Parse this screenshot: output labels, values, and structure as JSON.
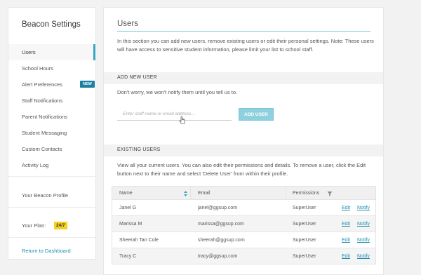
{
  "sidebar": {
    "title": "Beacon Settings",
    "items": [
      {
        "label": "Users"
      },
      {
        "label": "School Hours"
      },
      {
        "label": "Alert Preferences",
        "badge": "NEW"
      },
      {
        "label": "Staff Notifications"
      },
      {
        "label": "Parent Notifications"
      },
      {
        "label": "Student Messaging"
      },
      {
        "label": "Custom Contacts"
      },
      {
        "label": "Activity Log"
      }
    ],
    "profile_label": "Your Beacon Profile",
    "plan_label": "Your Plan:",
    "plan_badge": "24/7",
    "return_label": "Return to Dashboard",
    "accent_color": "#3aa3c2",
    "badge_new_color": "#1d7ea6",
    "badge_plan_color": "#f6d21e"
  },
  "main": {
    "title": "Users",
    "intro": "In this section you can add new users, remove existing users or edit their personal settings. Note: These users will have access to sensitive student information, please limit your list to school staff.",
    "add_section": {
      "heading": "ADD NEW USER",
      "note": "Don't worry, we won't notify them until you tell us to.",
      "input_placeholder": "Enter staff name or email address...",
      "button_label": "ADD USER"
    },
    "existing_section": {
      "heading": "EXISTING USERS",
      "description": "View all your current users. You can also edit their permissions and details. To remove a user, click the Edit button next to their name and select 'Delete User' from within their profile.",
      "columns": [
        "Name",
        "Email",
        "Permissions"
      ],
      "rows": [
        {
          "name": "Janel G",
          "email": "janel@ggsup.com",
          "permissions": "SuperUser",
          "edit": "Edit",
          "notify": "Notify"
        },
        {
          "name": "Marissa M",
          "email": "marissa@ggsup.com",
          "permissions": "SuperUser",
          "edit": "Edit",
          "notify": "Notify"
        },
        {
          "name": "Sheerah Tan Cole",
          "email": "sheerah@ggsup.com",
          "permissions": "SuperUser",
          "edit": "Edit",
          "notify": "Notify"
        },
        {
          "name": "Tracy C",
          "email": "tracy@ggsup.com",
          "permissions": "SuperUser",
          "edit": "Edit",
          "notify": "Notify"
        }
      ]
    },
    "link_color": "#1e8fb0",
    "rule_color": "#7fcce0"
  },
  "icons": {
    "sort": "sort-icon",
    "filter": "filter-icon",
    "cursor": "cursor-pointer-icon"
  }
}
